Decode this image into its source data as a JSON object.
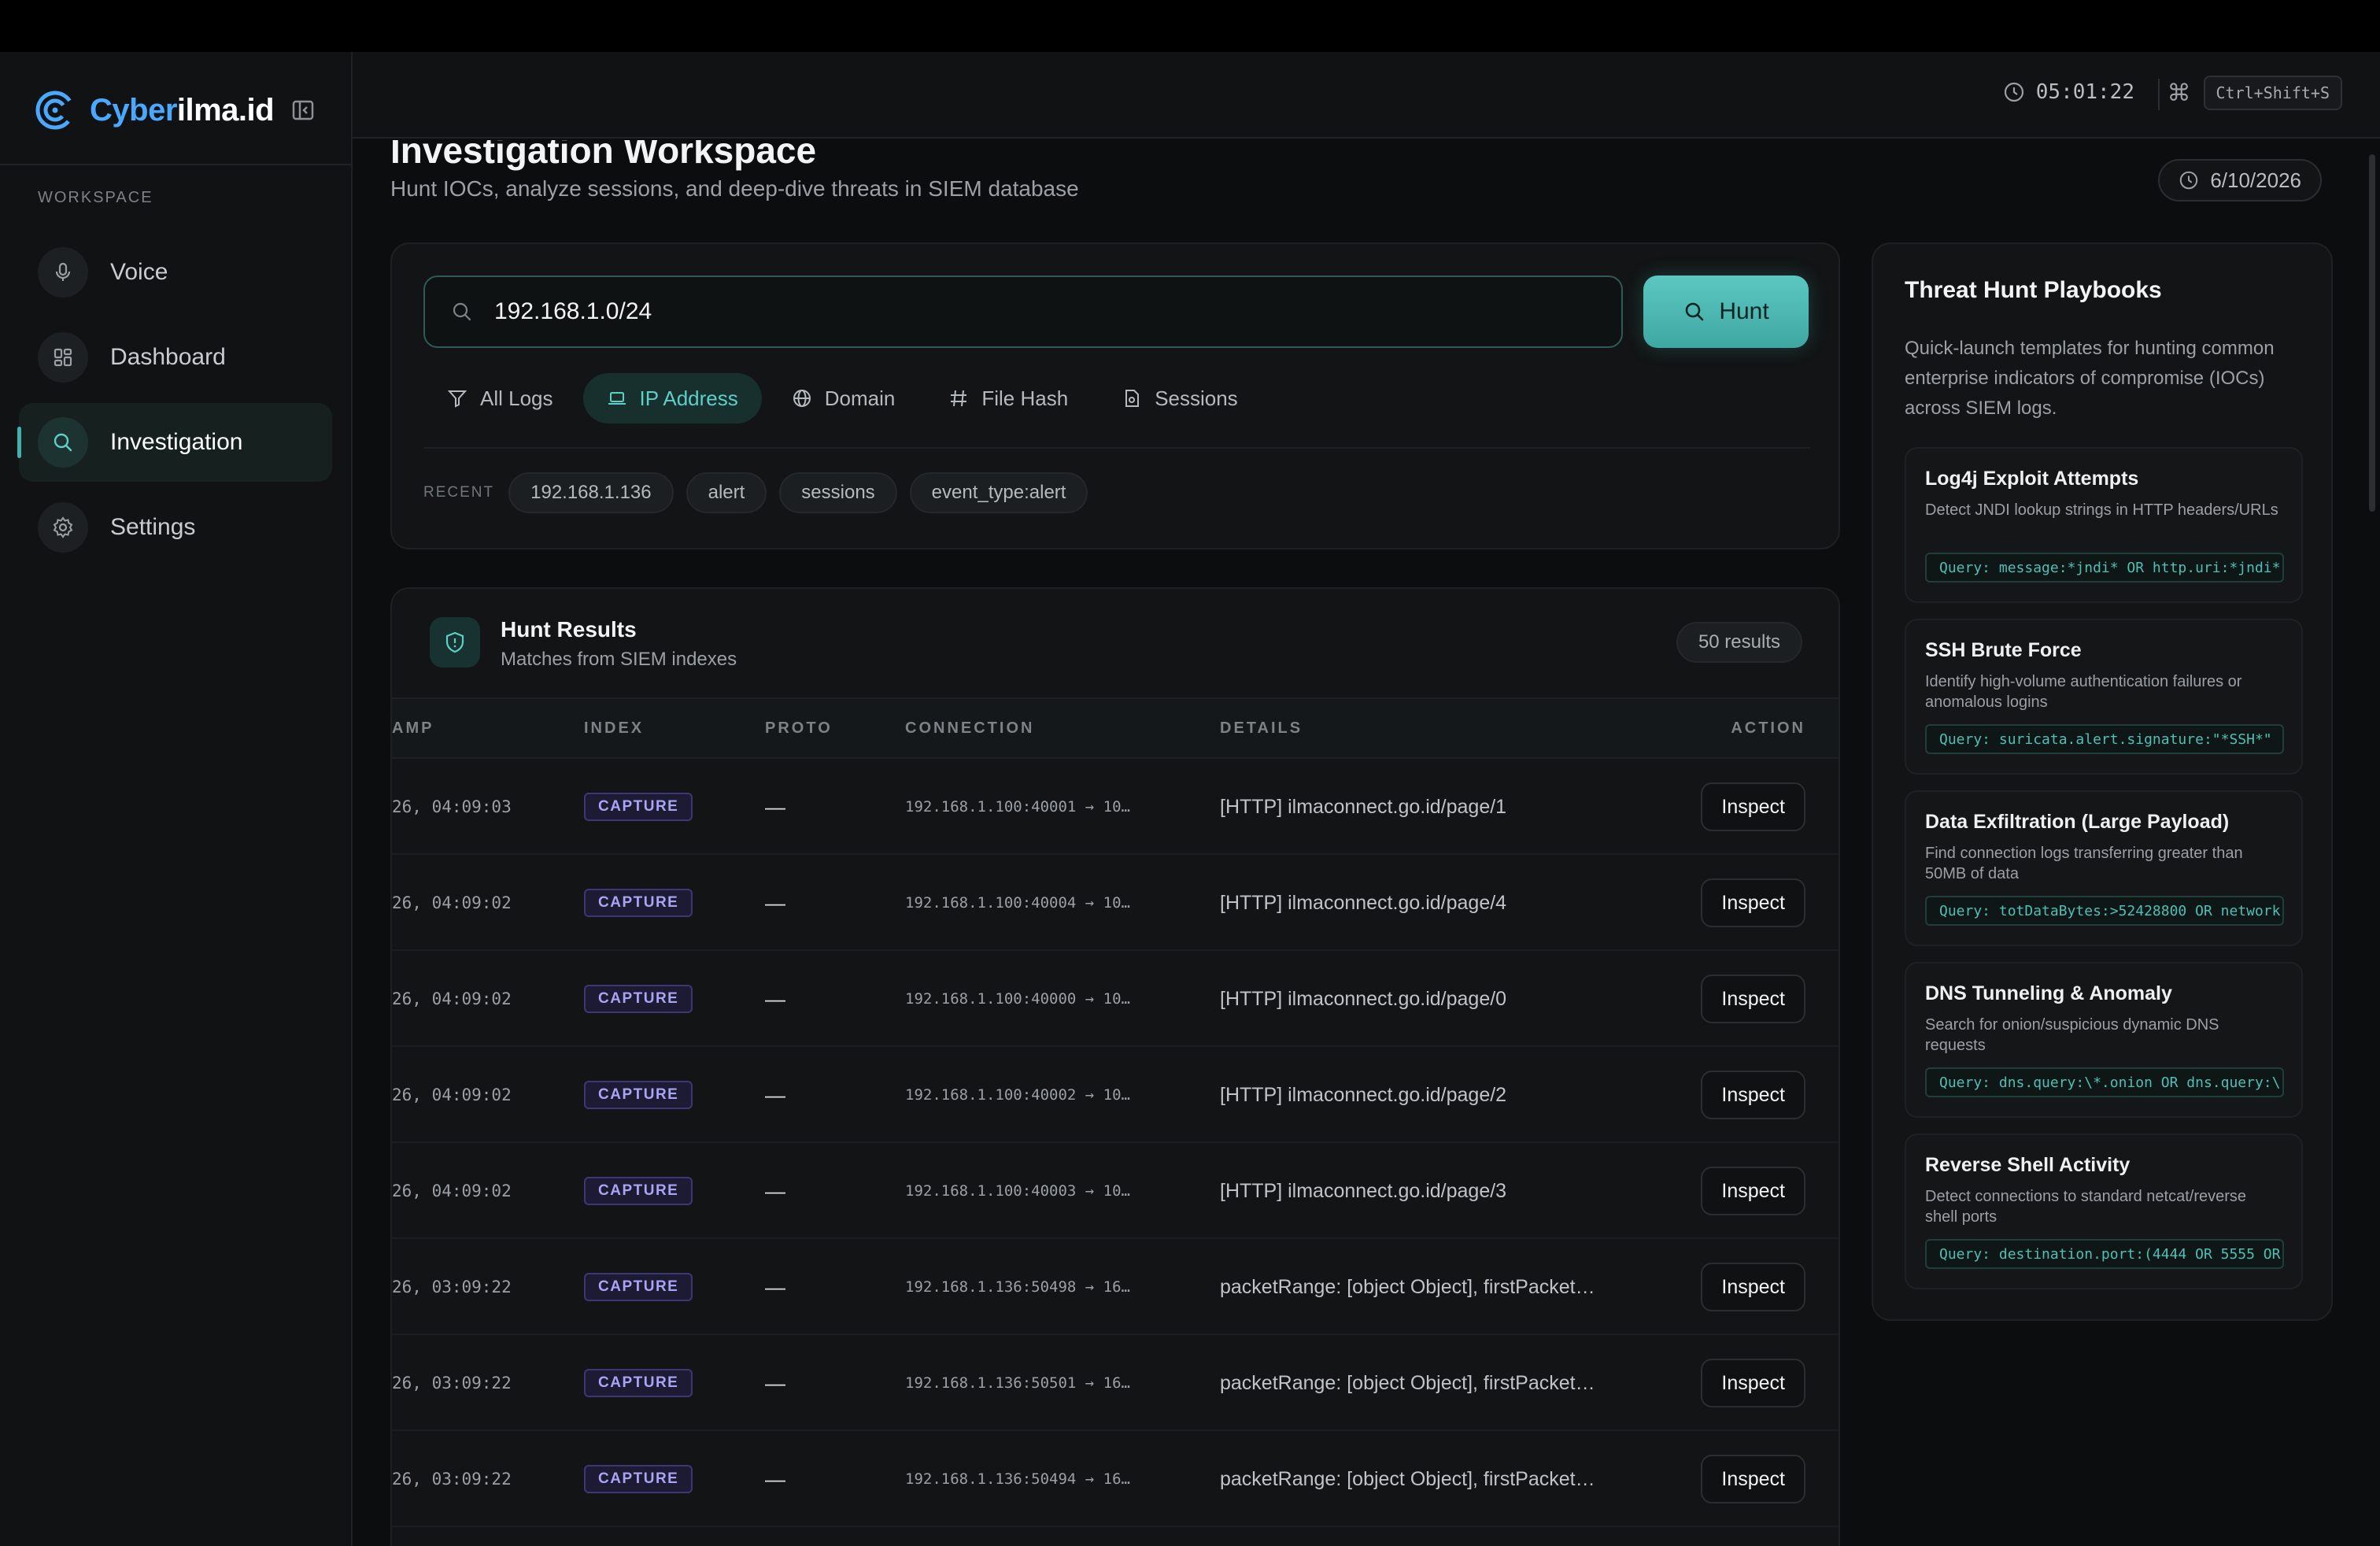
{
  "brand": {
    "name_a": "Cyber",
    "name_b": "ilma.id"
  },
  "sidebar": {
    "section_label": "WORKSPACE",
    "items": [
      {
        "label": "Voice",
        "icon": "microphone-icon"
      },
      {
        "label": "Dashboard",
        "icon": "grid-icon"
      },
      {
        "label": "Investigation",
        "icon": "search-icon",
        "active": true
      },
      {
        "label": "Settings",
        "icon": "gear-icon"
      }
    ]
  },
  "header": {
    "clock": "05:01:22",
    "shortcut": "Ctrl+Shift+S"
  },
  "page": {
    "title": "Investigation Workspace",
    "subtitle": "Hunt IOCs, analyze sessions, and deep-dive threats in SIEM database",
    "date": "6/10/2026"
  },
  "search": {
    "value": "192.168.1.0/24",
    "hunt_label": "Hunt",
    "filters": [
      {
        "label": "All Logs",
        "icon": "filter-icon"
      },
      {
        "label": "IP Address",
        "icon": "laptop-icon",
        "active": true
      },
      {
        "label": "Domain",
        "icon": "globe-icon"
      },
      {
        "label": "File Hash",
        "icon": "hash-icon"
      },
      {
        "label": "Sessions",
        "icon": "file-icon"
      }
    ],
    "recent_label": "RECENT",
    "recent": [
      "192.168.1.136",
      "alert",
      "sessions",
      "event_type:alert"
    ]
  },
  "results": {
    "title": "Hunt Results",
    "subtitle": "Matches from SIEM indexes",
    "count": "50 results",
    "columns": {
      "timestamp": "AMP",
      "index": "INDEX",
      "proto": "PROTO",
      "connection": "CONNECTION",
      "details": "DETAILS",
      "action": "ACTION"
    },
    "rows": [
      {
        "ts": "26, 04:09:03",
        "index": "CAPTURE",
        "proto": "—",
        "conn": "192.168.1.100:40001 → 10…",
        "details": "[HTTP] ilmaconnect.go.id/page/1",
        "action": "Inspect"
      },
      {
        "ts": "26, 04:09:02",
        "index": "CAPTURE",
        "proto": "—",
        "conn": "192.168.1.100:40004 → 10…",
        "details": "[HTTP] ilmaconnect.go.id/page/4",
        "action": "Inspect"
      },
      {
        "ts": "26, 04:09:02",
        "index": "CAPTURE",
        "proto": "—",
        "conn": "192.168.1.100:40000 → 10…",
        "details": "[HTTP] ilmaconnect.go.id/page/0",
        "action": "Inspect"
      },
      {
        "ts": "26, 04:09:02",
        "index": "CAPTURE",
        "proto": "—",
        "conn": "192.168.1.100:40002 → 10…",
        "details": "[HTTP] ilmaconnect.go.id/page/2",
        "action": "Inspect"
      },
      {
        "ts": "26, 04:09:02",
        "index": "CAPTURE",
        "proto": "—",
        "conn": "192.168.1.100:40003 → 10…",
        "details": "[HTTP] ilmaconnect.go.id/page/3",
        "action": "Inspect"
      },
      {
        "ts": "26, 03:09:22",
        "index": "CAPTURE",
        "proto": "—",
        "conn": "192.168.1.136:50498 → 16…",
        "details": "packetRange: [object Object], firstPacket…",
        "action": "Inspect"
      },
      {
        "ts": "26, 03:09:22",
        "index": "CAPTURE",
        "proto": "—",
        "conn": "192.168.1.136:50501 → 16…",
        "details": "packetRange: [object Object], firstPacket…",
        "action": "Inspect"
      },
      {
        "ts": "26, 03:09:22",
        "index": "CAPTURE",
        "proto": "—",
        "conn": "192.168.1.136:50494 → 16…",
        "details": "packetRange: [object Object], firstPacket…",
        "action": "Inspect"
      }
    ]
  },
  "playbooks": {
    "title": "Threat Hunt Playbooks",
    "description": "Quick-launch templates for hunting common enterprise indicators of compromise (IOCs) across SIEM logs.",
    "items": [
      {
        "name": "Log4j Exploit Attempts",
        "text": "Detect JNDI lookup strings in HTTP headers/URLs",
        "query": "Query: message:*jndi* OR http.uri:*jndi*"
      },
      {
        "name": "SSH Brute Force",
        "text": "Identify high-volume authentication failures or anomalous logins",
        "query": "Query: suricata.alert.signature:\"*SSH*\""
      },
      {
        "name": "Data Exfiltration (Large Payload)",
        "text": "Find connection logs transferring greater than 50MB of data",
        "query": "Query: totDataBytes:>52428800 OR network"
      },
      {
        "name": "DNS Tunneling & Anomaly",
        "text": "Search for onion/suspicious dynamic DNS requests",
        "query": "Query: dns.query:\\*.onion OR dns.query:\\"
      },
      {
        "name": "Reverse Shell Activity",
        "text": "Detect connections to standard netcat/reverse shell ports",
        "query": "Query: destination.port:(4444 OR 5555 OR"
      }
    ]
  }
}
